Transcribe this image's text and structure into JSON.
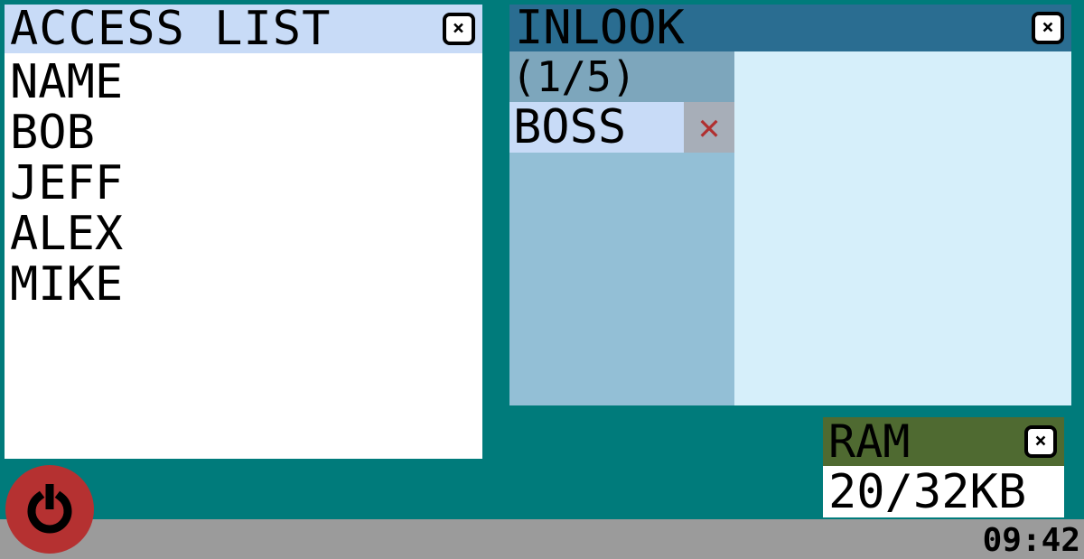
{
  "access_list": {
    "title": "ACCESS LIST",
    "items": [
      "NAME",
      "BOB",
      "JEFF",
      "ALEX",
      "MIKE"
    ]
  },
  "inlook": {
    "title": "INLOOK",
    "pager": "(1/5)",
    "messages": [
      {
        "sender": "BOSS",
        "delete_icon": "x-icon"
      }
    ]
  },
  "ram": {
    "title": "RAM",
    "value": "20/32KB"
  },
  "taskbar": {
    "clock": "09:42",
    "power_icon": "power-icon"
  },
  "colors": {
    "desktop": "#007b7b",
    "access_title": "#c8dbf7",
    "inlook_title": "#2a6d91",
    "ram_title": "#4f6a31",
    "power": "#b53131"
  }
}
